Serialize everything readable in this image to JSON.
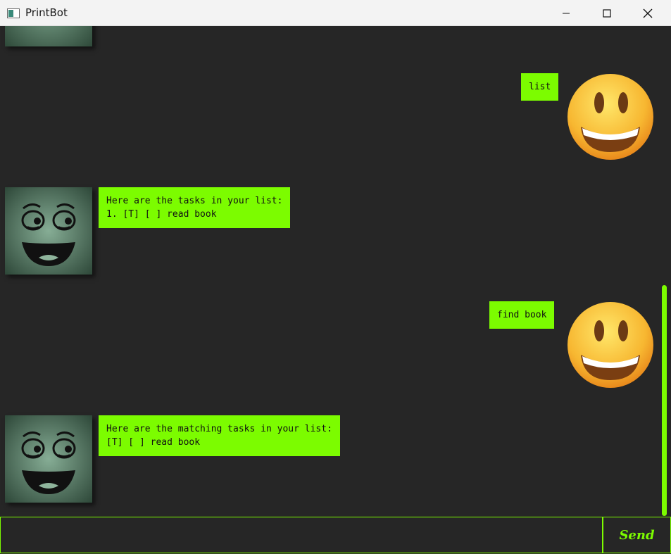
{
  "window": {
    "title": "PrintBot"
  },
  "messages": [
    {
      "sender": "bot",
      "text": ""
    },
    {
      "sender": "user",
      "text": "list"
    },
    {
      "sender": "bot",
      "text": "Here are the tasks in your list:\n1. [T] [ ] read book"
    },
    {
      "sender": "user",
      "text": "find book"
    },
    {
      "sender": "bot",
      "text": "Here are the matching tasks in your list:\n[T] [ ] read book"
    }
  ],
  "input": {
    "value": "",
    "placeholder": ""
  },
  "send_button": {
    "label": "Send"
  },
  "colors": {
    "background": "#262626",
    "accent": "#7cfc00",
    "titlebar": "#f3f3f3"
  },
  "icons": {
    "app": "app-window-icon",
    "bot_avatar": "cartoon-face-avatar",
    "user_avatar": "smiley-emoji-avatar"
  }
}
